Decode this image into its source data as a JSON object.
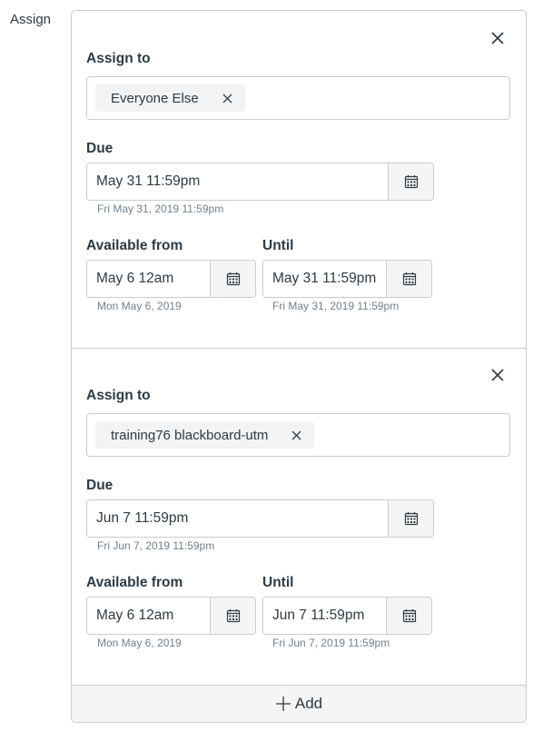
{
  "side_label": "Assign",
  "overrides": [
    {
      "assign_to_label": "Assign to",
      "assignees": [
        "Everyone Else"
      ],
      "due_label": "Due",
      "due_value": "May 31 11:59pm",
      "due_hint": "Fri May 31, 2019 11:59pm",
      "available_from_label": "Available from",
      "available_from_value": "May 6 12am",
      "available_from_hint": "Mon May 6, 2019",
      "until_label": "Until",
      "until_value": "May 31 11:59pm",
      "until_hint": "Fri May 31, 2019 11:59pm"
    },
    {
      "assign_to_label": "Assign to",
      "assignees": [
        "training76 blackboard-utm"
      ],
      "due_label": "Due",
      "due_value": "Jun 7 11:59pm",
      "due_hint": "Fri Jun 7, 2019 11:59pm",
      "available_from_label": "Available from",
      "available_from_value": "May 6 12am",
      "available_from_hint": "Mon May 6, 2019",
      "until_label": "Until",
      "until_value": "Jun 7 11:59pm",
      "until_hint": "Fri Jun 7, 2019 11:59pm"
    }
  ],
  "add_button_label": "Add",
  "icons": {
    "close": "close-icon",
    "remove_assignee": "close-icon",
    "calendar": "calendar-icon",
    "add": "plus-icon"
  }
}
